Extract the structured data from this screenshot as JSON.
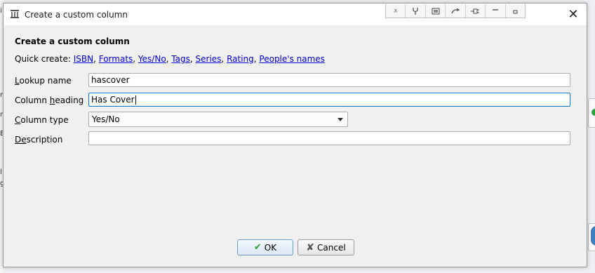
{
  "window": {
    "title": "Create a custom column",
    "close_glyph": "✕",
    "toolbar_icons": [
      "scroll-down-icon",
      "wrench-icon",
      "screen-icon",
      "undo-icon",
      "plug-icon",
      "minimize-icon",
      "restore-icon"
    ]
  },
  "dialog": {
    "heading": "Create a custom column",
    "quick_create_label": "Quick create:",
    "quick_links": [
      "ISBN",
      "Formats",
      "Yes/No",
      "Tags",
      "Series",
      "Rating",
      "People's names"
    ]
  },
  "form": {
    "lookup_name": {
      "label_prefix": "",
      "label_underlined": "L",
      "label_rest": "ookup name",
      "value": "hascover"
    },
    "column_heading": {
      "label_prefix": "Column ",
      "label_underlined": "h",
      "label_rest": "eading",
      "value": "Has Cover"
    },
    "column_type": {
      "label_prefix": "",
      "label_underlined": "C",
      "label_rest": "olumn type",
      "value": "Yes/No"
    },
    "description": {
      "label_prefix": "",
      "label_underlined": "De",
      "label_rest": "scription",
      "value": ""
    }
  },
  "buttons": {
    "ok_label": "OK",
    "cancel_label": "Cancel"
  },
  "background": {
    "left_fragments": [
      "i",
      "r",
      "r",
      "B",
      "l",
      "g"
    ]
  },
  "colors": {
    "link": "#0000cc",
    "focus_border": "#0078d7",
    "ok_icon": "#2e9e2e"
  }
}
